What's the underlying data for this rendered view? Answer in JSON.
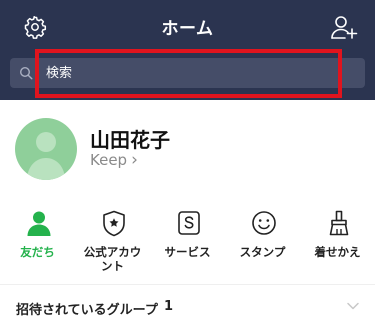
{
  "header": {
    "title": "ホーム",
    "settings_icon": "gear-icon",
    "add_friend_icon": "add-friend-icon",
    "background_color": "#2b3450"
  },
  "search": {
    "placeholder": "検索",
    "highlight_color": "#e0141e"
  },
  "profile": {
    "name": "山田花子",
    "keep_label": "Keep",
    "keep_chevron": "›"
  },
  "shortcuts": [
    {
      "label": "友だち",
      "icon": "person-icon",
      "active": true
    },
    {
      "label": "公式アカウ\nント",
      "icon": "official-account-shield-icon",
      "active": false
    },
    {
      "label": "サービス",
      "icon": "services-s-icon",
      "active": false
    },
    {
      "label": "スタンプ",
      "icon": "smiley-sticker-icon",
      "active": false
    },
    {
      "label": "着せかえ",
      "icon": "brush-theme-icon",
      "active": false
    }
  ],
  "accent_color": "#24b24c",
  "groups": {
    "title": "招待されているグループ",
    "count": "1",
    "chevron_icon": "chevron-down-icon"
  }
}
